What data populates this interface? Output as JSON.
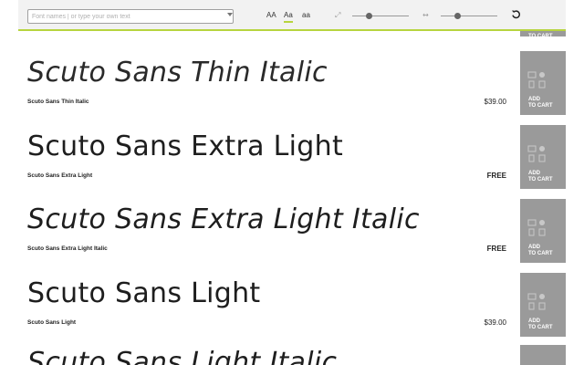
{
  "toolbar": {
    "search_placeholder": "Font names | or type your own text",
    "case_options": [
      "AA",
      "Aa",
      "aa"
    ],
    "active_case": "Aa",
    "size_slider_value": 0.3,
    "spacing_slider_value": 0.3
  },
  "partial_cart_label": "ADD\nTO CART",
  "fonts": [
    {
      "sample": "Scuto Sans Thin Italic",
      "name": "Scuto Sans Thin Italic",
      "price": "$39.00",
      "italic": true,
      "weight": "thin"
    },
    {
      "sample": "Scuto Sans Extra Light",
      "name": "Scuto Sans Extra Light",
      "price": "FREE",
      "italic": false,
      "weight": "extra-light"
    },
    {
      "sample": "Scuto Sans Extra Light Italic",
      "name": "Scuto Sans Extra Light Italic",
      "price": "FREE",
      "italic": true,
      "weight": "extra-light"
    },
    {
      "sample": "Scuto Sans Light",
      "name": "Scuto Sans Light",
      "price": "$39.00",
      "italic": false,
      "weight": "light"
    },
    {
      "sample": "Scuto Sans Light Italic",
      "name": "",
      "price": "",
      "italic": true,
      "weight": "light"
    }
  ],
  "cart_button_label": "ADD\nTO CART",
  "colors": {
    "accent": "#b7d43f",
    "cart_bg": "#9a9a9a",
    "toolbar_bg": "#f2f2f2"
  },
  "icons": {
    "size": "expand-arrows-icon",
    "spacing": "horizontal-arrows-icon",
    "reset": "undo-icon",
    "cart": "devices-icon"
  }
}
